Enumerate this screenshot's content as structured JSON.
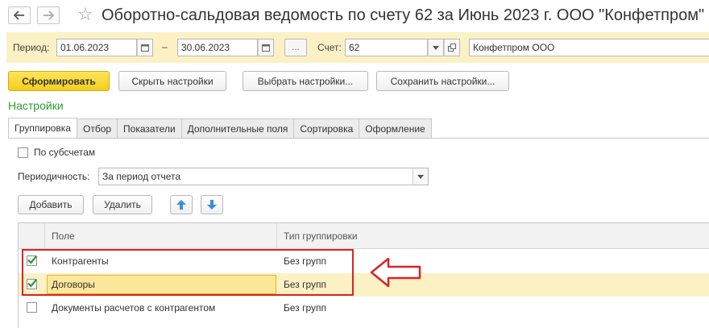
{
  "window": {
    "title": "Оборотно-сальдовая ведомость по счету 62 за Июнь 2023 г. ООО \"Конфетпром\""
  },
  "filters": {
    "period_label": "Период:",
    "date_from": "01.06.2023",
    "dash": "–",
    "date_to": "30.06.2023",
    "more_label": "...",
    "account_label": "Счет:",
    "account_value": "62",
    "org_value": "Конфетпром ООО"
  },
  "actions": {
    "generate": "Сформировать",
    "hide_settings": "Скрыть настройки",
    "choose_settings": "Выбрать настройки...",
    "save_settings": "Сохранить настройки..."
  },
  "settings": {
    "title": "Настройки",
    "tabs": [
      {
        "label": "Группировка",
        "active": true
      },
      {
        "label": "Отбор"
      },
      {
        "label": "Показатели"
      },
      {
        "label": "Дополнительные поля"
      },
      {
        "label": "Сортировка"
      },
      {
        "label": "Оформление"
      }
    ],
    "subaccounts_label": "По субсчетам",
    "periodicity_label": "Периодичность:",
    "periodicity_value": "За период отчета",
    "add_button": "Добавить",
    "delete_button": "Удалить"
  },
  "grid": {
    "columns": [
      "Поле",
      "Тип группировки"
    ],
    "rows": [
      {
        "field": "Контрагенты",
        "type": "Без групп",
        "checked": true
      },
      {
        "field": "Договоры",
        "type": "Без групп",
        "checked": true,
        "selected": true
      },
      {
        "field": "Документы расчетов с контрагентом",
        "type": "Без групп",
        "checked": false
      }
    ]
  },
  "colors": {
    "accent_yellow": "#f5cd1c",
    "highlight_bg": "#fbf1c4",
    "settings_green": "#2e9a2e",
    "annotation_red": "#d9232a",
    "check_green": "#2a9a3a"
  }
}
